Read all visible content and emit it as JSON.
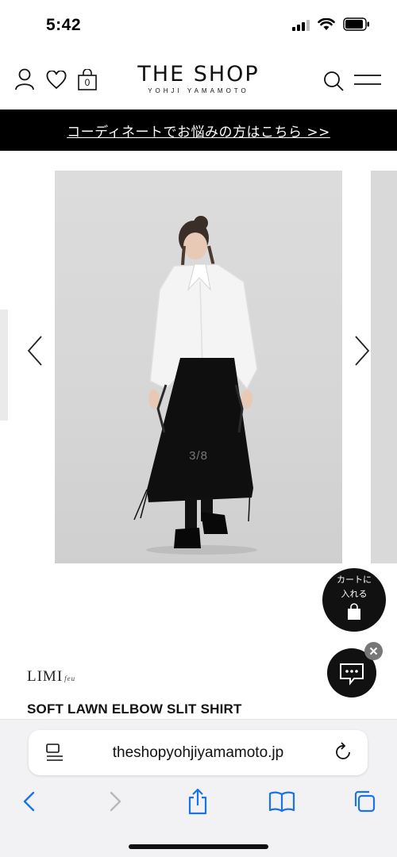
{
  "status_bar": {
    "time": "5:42"
  },
  "header": {
    "logo_main": "THE SHOP",
    "logo_sub": "YOHJI YAMAMOTO",
    "cart_count": "0",
    "icons": [
      "account-icon",
      "heart-icon",
      "shopping-bag-icon",
      "search-icon",
      "menu-icon"
    ]
  },
  "banner": {
    "text": "コーディネートでお悩みの方はこちら >>"
  },
  "gallery": {
    "counter": "3/8"
  },
  "cart_fab": {
    "line1": "カートに",
    "line2": "入れる"
  },
  "product": {
    "brand": "LIMI",
    "brand_suffix": "feu",
    "title": "SOFT LAWN ELBOW SLIT SHIRT"
  },
  "browser": {
    "url": "theshopyohjiyamamoto.jp"
  },
  "colors": {
    "banner_bg": "#000000",
    "accent": "#111111",
    "browser_icon": "#1a73e8"
  }
}
